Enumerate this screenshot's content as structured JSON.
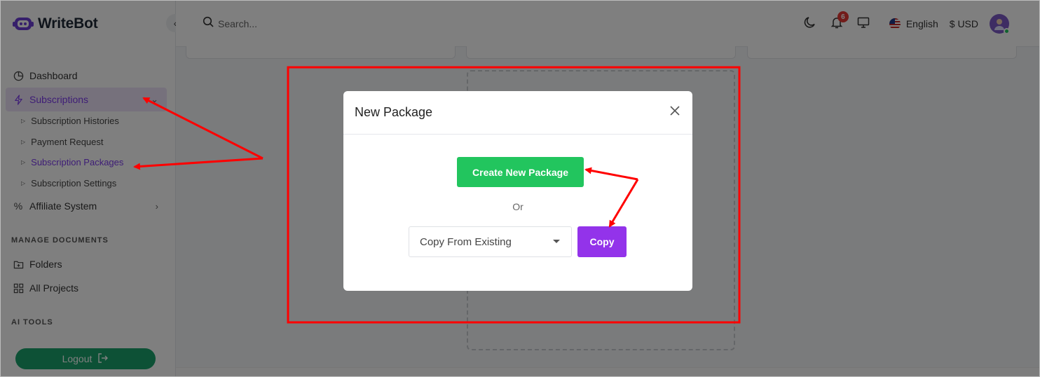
{
  "brand": {
    "name": "WriteBot"
  },
  "search": {
    "placeholder": "Search..."
  },
  "topbar": {
    "notification_count": "6",
    "language": "English",
    "currency": "$ USD"
  },
  "sidebar": {
    "items": [
      {
        "label": "Dashboard",
        "icon": "pie-chart-icon"
      },
      {
        "label": "Subscriptions",
        "icon": "lightning-icon"
      },
      {
        "label": "Affiliate System",
        "icon": "percent-icon"
      },
      {
        "label": "Folders",
        "icon": "folder-plus-icon"
      },
      {
        "label": "All Projects",
        "icon": "grid-icon"
      }
    ],
    "sub_items": [
      {
        "label": "Subscription Histories"
      },
      {
        "label": "Payment Request"
      },
      {
        "label": "Subscription Packages"
      },
      {
        "label": "Subscription Settings"
      }
    ],
    "sections": [
      "MANAGE DOCUMENTS",
      "AI TOOLS"
    ],
    "logout_label": "Logout"
  },
  "modal": {
    "title": "New Package",
    "create_label": "Create New Package",
    "or_text": "Or",
    "select_value": "Copy From Existing",
    "copy_label": "Copy"
  },
  "colors": {
    "accent": "#7c3aed",
    "create_button": "#22c55e",
    "copy_button": "#9333ea",
    "logout_button": "#1aa36d",
    "annotation": "#ff0000"
  }
}
